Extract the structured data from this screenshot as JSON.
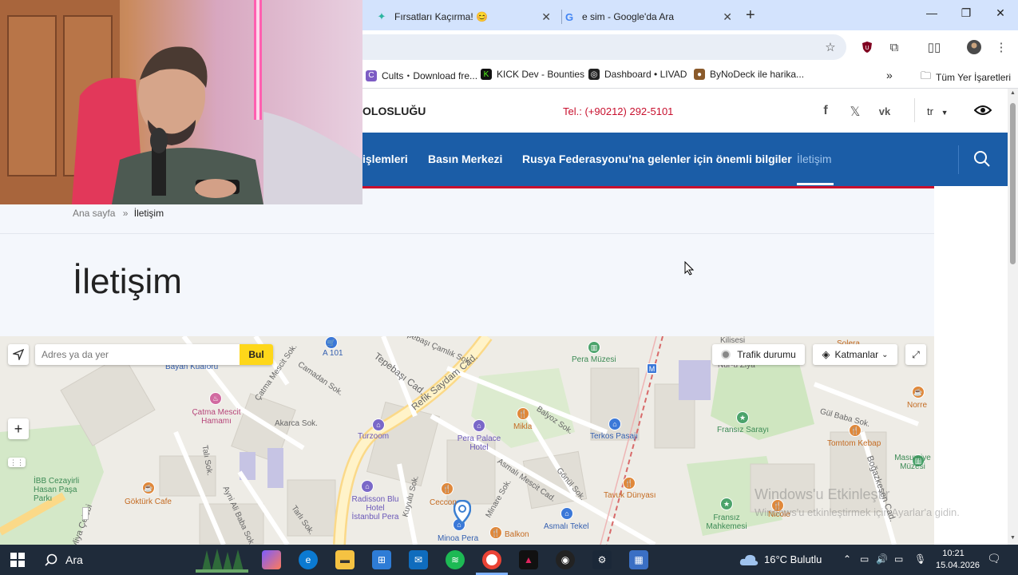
{
  "browser": {
    "tabs": [
      {
        "title": "Fırsatları Kaçırma! 😊"
      },
      {
        "title": "e sim - Google'da Ara"
      }
    ],
    "new_tab": "+",
    "window_controls": {
      "minimize": "—",
      "restore": "❐",
      "close": "✕"
    },
    "bookmarks": [
      {
        "label": "Cults・Download fre..."
      },
      {
        "label": "KICK Dev - Bounties"
      },
      {
        "label": "Dashboard • LIVAD"
      },
      {
        "label": "ByNoDeck ile harika..."
      }
    ],
    "bookmarks_overflow": "»",
    "all_bookmarks": "Tüm Yer İşaretleri"
  },
  "site": {
    "name_fragment": "OLOSLUĞU",
    "phone": "Tel.: (+90212) 292-5101",
    "lang": "tr",
    "nav": [
      {
        "label": "işlemleri"
      },
      {
        "label": "Basın Merkezi"
      },
      {
        "label": "Rusya Federasyonu’na gelenler için önemli bilgiler"
      },
      {
        "label": "İletişim"
      }
    ],
    "breadcrumb": {
      "home": "Ana sayfa",
      "separator": "»",
      "current": "İletişim"
    },
    "title": "İletişim"
  },
  "map": {
    "search_placeholder": "Adres ya da yer",
    "search_value": "",
    "find_button": "Bul",
    "traffic_button": "Trafik durumu",
    "layers_button": "Katmanlar",
    "zoom_in": "+",
    "labels": [
      {
        "text": "A 101",
        "cls": "blue"
      },
      {
        "text": "Bayan Kuaförü",
        "cls": "blue"
      },
      {
        "text": "Çatma Mescit Hamamı",
        "cls": "pink"
      },
      {
        "text": "Turzoom",
        "cls": "purple"
      },
      {
        "text": "Pera Palace Hotel",
        "cls": "purple"
      },
      {
        "text": "Mikla",
        "cls": "orange"
      },
      {
        "text": "Pera Müzesi",
        "cls": "green"
      },
      {
        "text": "Terkos Pasajı",
        "cls": "blue"
      },
      {
        "text": "Fransız Sarayı",
        "cls": "green"
      },
      {
        "text": "Tomtom Kebap",
        "cls": "orange"
      },
      {
        "text": "Masumiye Müzesi",
        "cls": "green"
      },
      {
        "text": "Norre",
        "cls": "orange"
      },
      {
        "text": "İBB Cezayirli Hasan Paşa Parkı",
        "cls": "green"
      },
      {
        "text": "Göktürk Cafe",
        "cls": "orange"
      },
      {
        "text": "Radisson Blu Hotel İstanbul Pera",
        "cls": "purple"
      },
      {
        "text": "Ceccon",
        "cls": "orange"
      },
      {
        "text": "Minoa Pera",
        "cls": "blue"
      },
      {
        "text": "Balkon",
        "cls": "orange"
      },
      {
        "text": "Asmalı Tekel",
        "cls": "blue"
      },
      {
        "text": "Tavuk Dünyası",
        "cls": "orange"
      },
      {
        "text": "Fransız Mahkemesi",
        "cls": "green"
      },
      {
        "text": "Nicole",
        "cls": "orange"
      },
      {
        "text": "Kilisesi",
        "cls": "street"
      },
      {
        "text": "Solera",
        "cls": "orange"
      },
      {
        "text": "Nur-u Ziya",
        "cls": "street"
      },
      {
        "text": "Tepebaşı Cad.",
        "cls": "street"
      },
      {
        "text": "Refik Saydam Cad.",
        "cls": "street"
      },
      {
        "text": "Tepebaşı Çamlık Sok.",
        "cls": "street"
      },
      {
        "text": "Çatma Mescit Sok.",
        "cls": "street"
      },
      {
        "text": "Camadan Sok.",
        "cls": "street"
      },
      {
        "text": "Akarca Sok.",
        "cls": "street"
      },
      {
        "text": "Balyoz Sok.",
        "cls": "street"
      },
      {
        "text": "Asmalı Mescit Cad.",
        "cls": "street"
      },
      {
        "text": "Gönül Sok.",
        "cls": "street"
      },
      {
        "text": "Gül Baba Sok.",
        "cls": "street"
      },
      {
        "text": "Boğazkesen Cad.",
        "cls": "street"
      },
      {
        "text": "Talı Sok.",
        "cls": "street"
      },
      {
        "text": "Ayni Ali Baba Sok.",
        "cls": "street"
      },
      {
        "text": "Evliya Çelebi",
        "cls": "street"
      },
      {
        "text": "Kuyulu Sok.",
        "cls": "street"
      },
      {
        "text": "Minare Sok.",
        "cls": "street"
      },
      {
        "text": "Tarlı Sok.",
        "cls": "street"
      }
    ]
  },
  "watermark": {
    "title": "Windows'u Etkinleştir",
    "subtitle": "Windows'u etkinleştirmek için Ayarlar'a gidin."
  },
  "taskbar": {
    "search_label": "Ara",
    "weather": "16°C  Bulutlu",
    "time": "10:21",
    "date": "15.04.2026"
  },
  "colors": {
    "nav_blue": "#1b5da7",
    "accent_red": "#c8102e",
    "map_find_yellow": "#fed71a",
    "tabbar": "#d3e3fd"
  }
}
